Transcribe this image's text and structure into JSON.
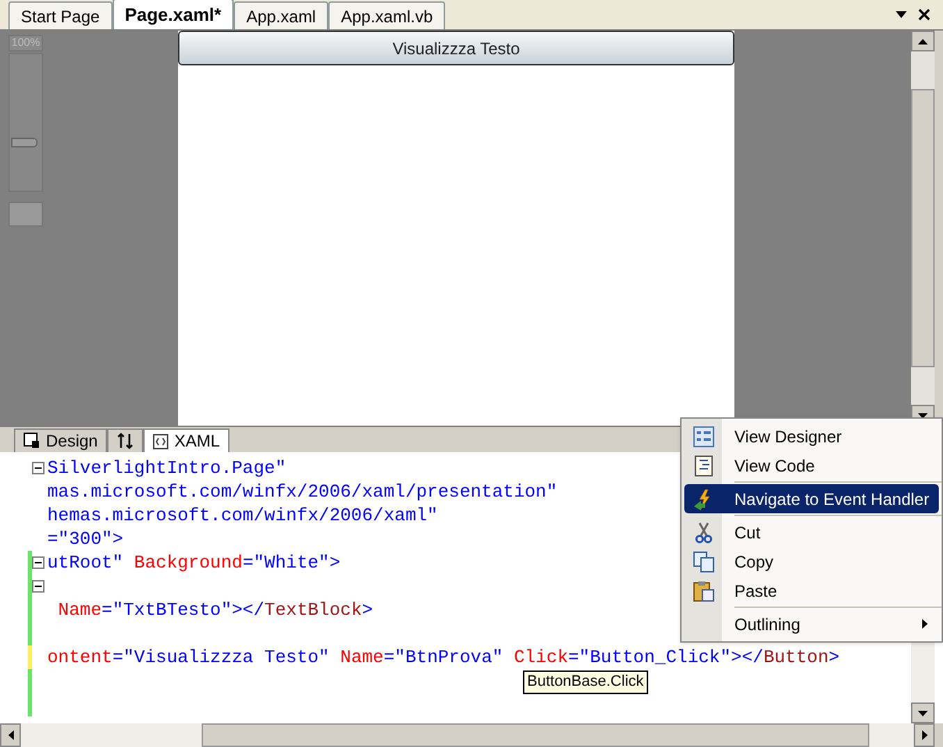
{
  "doc_tabs": [
    {
      "label": "Start Page",
      "selected": false
    },
    {
      "label": "Page.xaml*",
      "selected": true
    },
    {
      "label": "App.xaml",
      "selected": false
    },
    {
      "label": "App.xaml.vb",
      "selected": false
    }
  ],
  "zoom": {
    "label": "100%",
    "level": 0.35
  },
  "design_surface": {
    "button_label": "Visualizzza Testo"
  },
  "view_tabs": [
    {
      "label": "Design",
      "kind": "design",
      "selected": false
    },
    {
      "kind": "swap",
      "selected": false
    },
    {
      "label": "XAML",
      "kind": "xaml",
      "selected": true
    }
  ],
  "code_lines": [
    {
      "fold": true,
      "tokens": [
        {
          "kind": "value",
          "text": "SilverlightIntro.Page\""
        }
      ]
    },
    {
      "tokens": [
        {
          "kind": "value",
          "text": "mas.microsoft.com/winfx/2006/xaml/presentation\""
        }
      ]
    },
    {
      "tokens": [
        {
          "kind": "value",
          "text": "hemas.microsoft.com/winfx/2006/xaml\""
        }
      ]
    },
    {
      "tokens": [
        {
          "kind": "value",
          "text": "=\"300\">"
        }
      ]
    },
    {
      "fold": true,
      "color": "#6ce26c",
      "tokens": [
        {
          "kind": "value",
          "text": "utRoot\" "
        },
        {
          "kind": "attribute",
          "text": "Background"
        },
        {
          "kind": "value",
          "text": "=\"White\">"
        }
      ]
    },
    {
      "fold": true,
      "color": "#6ce26c"
    },
    {
      "color": "#6ce26c",
      "tokens": [
        {
          "kind": "attribute",
          "text": " Name"
        },
        {
          "kind": "value",
          "text": "=\"TxtBTesto\"></"
        },
        {
          "kind": "element",
          "text": "TextBlock"
        },
        {
          "kind": "value",
          "text": ">"
        }
      ]
    },
    {
      "color": "#6ce26c"
    },
    {
      "color": "#ffee62",
      "tokens": [
        {
          "kind": "attribute",
          "text": "ontent"
        },
        {
          "kind": "value",
          "text": "=\"Visualizzza Testo\" "
        },
        {
          "kind": "attribute",
          "text": "Name"
        },
        {
          "kind": "value",
          "text": "=\"BtnProva\" "
        },
        {
          "kind": "attribute",
          "text": "Click"
        },
        {
          "kind": "value",
          "text": "=\"Button_Click\"></"
        },
        {
          "kind": "element",
          "text": "Button"
        },
        {
          "kind": "value",
          "text": ">"
        }
      ]
    },
    {
      "color": "#6ce26c"
    },
    {
      "color": "#6ce26c"
    }
  ],
  "tooltip": "ButtonBase.Click",
  "context_menu": {
    "groups": [
      [
        {
          "label": "View Designer",
          "kind": "designer",
          "selected": false
        },
        {
          "label": "View Code",
          "kind": "code",
          "selected": false
        }
      ],
      [
        {
          "label": "Navigate to Event Handler",
          "kind": "event",
          "selected": true
        }
      ],
      [
        {
          "label": "Cut",
          "kind": "cut",
          "selected": false
        },
        {
          "label": "Copy",
          "kind": "copy",
          "selected": false
        },
        {
          "label": "Paste",
          "kind": "paste",
          "selected": false
        }
      ],
      [
        {
          "label": "Outlining",
          "kind": "submenu",
          "selected": false
        }
      ]
    ]
  }
}
